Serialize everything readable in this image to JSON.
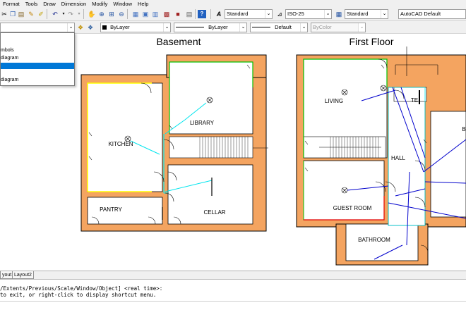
{
  "menu": [
    "Format",
    "Tools",
    "Draw",
    "Dimension",
    "Modify",
    "Window",
    "Help"
  ],
  "toolbar": {
    "text_style": "Standard",
    "dim_style": "ISO-25",
    "table_style": "Standard",
    "workspace": "AutoCAD Default"
  },
  "properties": {
    "color": "ByLayer",
    "linetype": "ByLayer",
    "lineweight": "Default",
    "plotstyle": "ByColor"
  },
  "dropdown": {
    "items": [
      "mbols",
      "diagram",
      "",
      "diagram"
    ]
  },
  "drawing": {
    "title_basement": "Basement",
    "title_first_floor": "First Floor",
    "rooms": {
      "kitchen": "KITCHEN",
      "library": "LIBRARY",
      "pantry": "PANTRY",
      "cellar": "CELLAR",
      "living": "LIVING",
      "te": "TE",
      "hall": "HALL",
      "guest_room": "GUEST ROOM",
      "bathroom": "BATHROOM",
      "b_partial": "B"
    }
  },
  "tabs": [
    "yout1",
    "Layout2"
  ],
  "command": {
    "line1": "/Extents/Previous/Scale/Window/Object] <real time>:",
    "line2": "to exit, or right-click to display shortcut menu."
  },
  "colors": {
    "wall": "#f4a460",
    "wall_border": "#000000",
    "green": "#00c000",
    "yellow": "#ffff00",
    "cyan": "#00e5ee",
    "blue": "#0000cc",
    "red": "#e00000",
    "selection": "#0078d7"
  }
}
